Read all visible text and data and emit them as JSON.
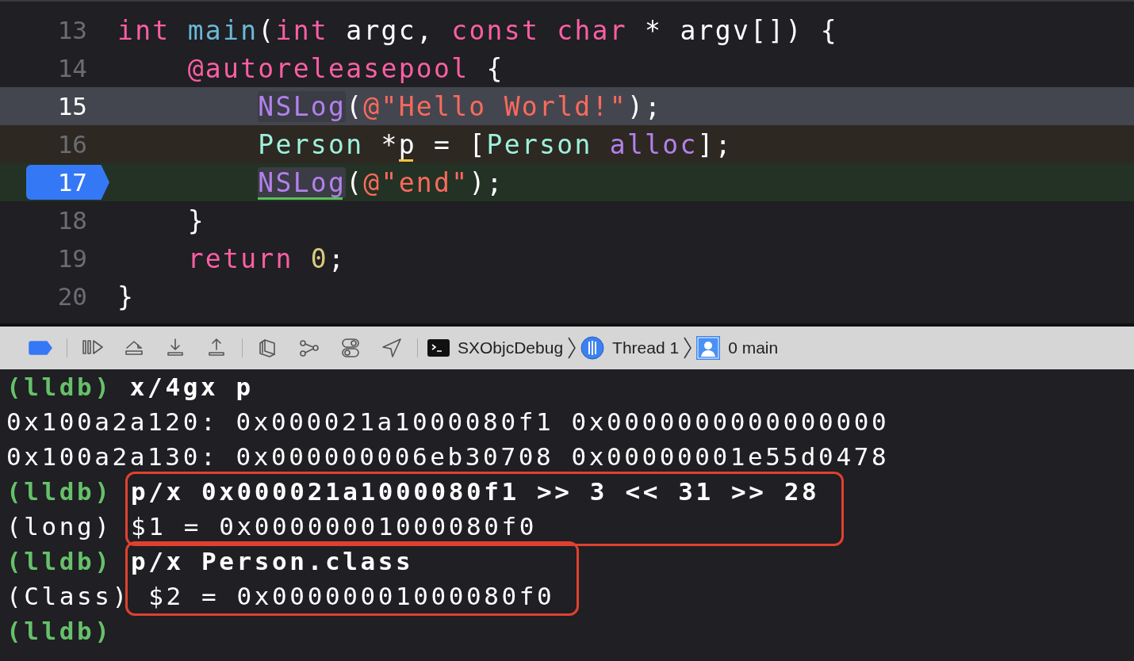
{
  "editor": {
    "lines": [
      {
        "number": "13",
        "kind": "plain",
        "breakpoint": false,
        "tokens": [
          {
            "text": "int",
            "kind": "keyword"
          },
          {
            "text": " main",
            "kind": "function"
          },
          {
            "text": "(",
            "kind": "plain"
          },
          {
            "text": "int",
            "kind": "keyword"
          },
          {
            "text": " argc, ",
            "kind": "plain"
          },
          {
            "text": "const",
            "kind": "keyword"
          },
          {
            "text": " char",
            "kind": "keyword"
          },
          {
            "text": " * argv[]) {",
            "kind": "plain"
          }
        ]
      },
      {
        "number": "14",
        "kind": "plain",
        "breakpoint": false,
        "tokens": [
          {
            "text": "    @autoreleasepool",
            "kind": "keyword"
          },
          {
            "text": " {",
            "kind": "plain"
          }
        ]
      },
      {
        "number": "15",
        "kind": "selected",
        "breakpoint": false,
        "tokens": [
          {
            "text": "        NSLog",
            "kind": "method",
            "boxed": true
          },
          {
            "text": "(",
            "kind": "plain"
          },
          {
            "text": "@\"Hello World!\"",
            "kind": "string"
          },
          {
            "text": ");",
            "kind": "plain"
          }
        ]
      },
      {
        "number": "16",
        "kind": "previous",
        "breakpoint": false,
        "tokens": [
          {
            "text": "        Person",
            "kind": "type"
          },
          {
            "text": " *",
            "kind": "plain"
          },
          {
            "text": "p",
            "kind": "plain",
            "underline": {
              "color": "#f5c33b"
            }
          },
          {
            "text": " = [",
            "kind": "plain"
          },
          {
            "text": "Person",
            "kind": "type"
          },
          {
            "text": " alloc",
            "kind": "method"
          },
          {
            "text": "];",
            "kind": "plain"
          }
        ]
      },
      {
        "number": "17",
        "kind": "current",
        "breakpoint": true,
        "tokens": [
          {
            "text": "        NSLog",
            "kind": "method",
            "boxed": true,
            "underline": {
              "color": "#5ac05a"
            }
          },
          {
            "text": "(",
            "kind": "plain"
          },
          {
            "text": "@\"end\"",
            "kind": "string"
          },
          {
            "text": ");",
            "kind": "plain"
          }
        ]
      },
      {
        "number": "18",
        "kind": "plain",
        "breakpoint": false,
        "tokens": [
          {
            "text": "    }",
            "kind": "plain"
          }
        ]
      },
      {
        "number": "19",
        "kind": "plain",
        "breakpoint": false,
        "tokens": [
          {
            "text": "    return",
            "kind": "keyword"
          },
          {
            "text": " 0",
            "kind": "number"
          },
          {
            "text": ";",
            "kind": "plain"
          }
        ]
      },
      {
        "number": "20",
        "kind": "plain",
        "breakpoint": false,
        "tokens": [
          {
            "text": "}",
            "kind": "plain"
          }
        ]
      }
    ]
  },
  "debug_bar": {
    "breakpoints_active": true,
    "crumbs": [
      {
        "kind": "target",
        "label": "SXObjcDebug"
      },
      {
        "kind": "thread",
        "label": "Thread 1"
      },
      {
        "kind": "frame",
        "label": "0 main"
      }
    ]
  },
  "console": [
    {
      "boxed": false,
      "lines": [
        {
          "kind": "command",
          "prompt": "(lldb)",
          "text": "x/4gx p"
        },
        {
          "kind": "output",
          "text": "0x100a2a120: 0x000021a1000080f1 0x0000000000000000"
        },
        {
          "kind": "output",
          "text": "0x100a2a130: 0x000000006eb30708 0x00000001e55d0478"
        }
      ]
    },
    {
      "boxed": true,
      "lines": [
        {
          "kind": "command",
          "prompt": "(lldb)",
          "text": "p/x 0x000021a1000080f1 >> 3 << 31 >> 28"
        },
        {
          "kind": "output",
          "prefix": "(long)",
          "text": "$1 = 0x00000001000080f0"
        }
      ]
    },
    {
      "boxed": true,
      "lines": [
        {
          "kind": "command",
          "prompt": "(lldb)",
          "text": "p/x Person.class"
        },
        {
          "kind": "output",
          "prefix": "(Class)",
          "text": " $2 = 0x00000001000080f0"
        }
      ]
    },
    {
      "boxed": false,
      "lines": [
        {
          "kind": "command",
          "prompt": "(lldb)"
        }
      ]
    }
  ]
}
